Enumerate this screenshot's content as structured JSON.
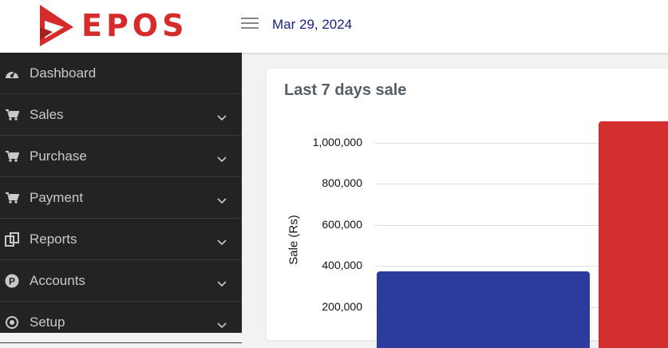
{
  "header": {
    "brand": "EPOS",
    "date": "Mar 29, 2024"
  },
  "sidebar": {
    "items": [
      {
        "label": "Dashboard",
        "icon": "dashboard-icon",
        "has_submenu": false
      },
      {
        "label": "Sales",
        "icon": "cart-icon",
        "has_submenu": true
      },
      {
        "label": "Purchase",
        "icon": "cart-icon",
        "has_submenu": true
      },
      {
        "label": "Payment",
        "icon": "cart-icon",
        "has_submenu": true
      },
      {
        "label": "Reports",
        "icon": "copy-icon",
        "has_submenu": true
      },
      {
        "label": "Accounts",
        "icon": "p-circle-icon",
        "has_submenu": true
      },
      {
        "label": "Setup",
        "icon": "dot-circle-icon",
        "has_submenu": true
      }
    ]
  },
  "card": {
    "title": "Last 7 days sale"
  },
  "chart_data": {
    "type": "bar",
    "title": "Last 7 days sale",
    "ylabel": "Sale (Rs)",
    "yticks": [
      "200,000",
      "400,000",
      "600,000",
      "800,000",
      "1,000,000"
    ],
    "ylim": [
      0,
      1000000
    ],
    "grid": true,
    "values": [
      375000,
      1105000
    ],
    "colors": [
      "#2e3b9e",
      "#d32f2f"
    ]
  }
}
